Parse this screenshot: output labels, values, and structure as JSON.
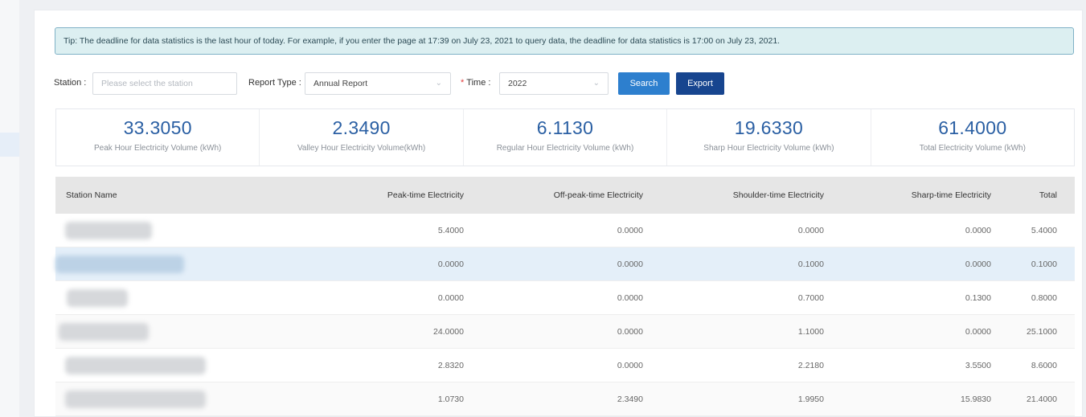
{
  "tip": "Tip: The deadline for data statistics is the last hour of today. For example, if you enter the page at 17:39 on July 23, 2021 to query data, the deadline for data statistics is 17:00 on July 23, 2021.",
  "filters": {
    "station_label": "Station :",
    "station_placeholder": "Please select the station",
    "report_type_label": "Report Type :",
    "report_type_value": "Annual Report",
    "time_required": "*",
    "time_label": "Time :",
    "time_value": "2022",
    "search_label": "Search",
    "export_label": "Export"
  },
  "stats": [
    {
      "value": "33.3050",
      "label": "Peak Hour Electricity Volume (kWh)"
    },
    {
      "value": "2.3490",
      "label": "Valley Hour Electricity Volume(kWh)"
    },
    {
      "value": "6.1130",
      "label": "Regular Hour Electricity Volume (kWh)"
    },
    {
      "value": "19.6330",
      "label": "Sharp Hour Electricity Volume (kWh)"
    },
    {
      "value": "61.4000",
      "label": "Total Electricity Volume (kWh)"
    }
  ],
  "table": {
    "headers": [
      "Station Name",
      "Peak-time Electricity",
      "Off-peak-time Electricity",
      "Shoulder-time Electricity",
      "Sharp-time Electricity",
      "Total"
    ],
    "rows": [
      {
        "peak": "5.4000",
        "offpeak": "0.0000",
        "shoulder": "0.0000",
        "sharp": "0.0000",
        "total": "5.4000"
      },
      {
        "peak": "0.0000",
        "offpeak": "0.0000",
        "shoulder": "0.1000",
        "sharp": "0.0000",
        "total": "0.1000"
      },
      {
        "peak": "0.0000",
        "offpeak": "0.0000",
        "shoulder": "0.7000",
        "sharp": "0.1300",
        "total": "0.8000"
      },
      {
        "peak": "24.0000",
        "offpeak": "0.0000",
        "shoulder": "1.1000",
        "sharp": "0.0000",
        "total": "25.1000"
      },
      {
        "peak": "2.8320",
        "offpeak": "0.0000",
        "shoulder": "2.2180",
        "sharp": "3.5500",
        "total": "8.6000"
      },
      {
        "peak": "1.0730",
        "offpeak": "2.3490",
        "shoulder": "1.9950",
        "sharp": "15.9830",
        "total": "21.4000"
      }
    ]
  },
  "colors": {
    "accent": "#2a5fa3",
    "search_button": "#2d7fce",
    "export_button": "#17458f",
    "tip_background": "#dceff1",
    "required": "#e23b3b"
  },
  "icons": {
    "select_arrow": "chevron-down-icon"
  }
}
